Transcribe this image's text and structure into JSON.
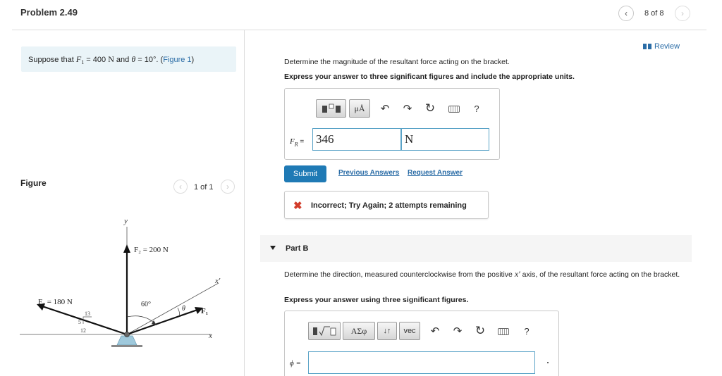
{
  "header": {
    "title": "Problem 2.49",
    "page_count": "8 of 8",
    "prev_icon": "chevron-left-icon",
    "next_icon": "chevron-right-icon"
  },
  "statement": {
    "prefix": "Suppose that ",
    "f1_symbol": "F",
    "f1_sub": "1",
    "f1_value": " = 400 ",
    "f1_unit": "N",
    "and": " and ",
    "theta_symbol": "θ",
    "theta_value": " = 10°. (",
    "figure_link": "Figure 1",
    "suffix": ")"
  },
  "figure": {
    "label": "Figure",
    "count": "1 of 1",
    "y_axis": "y",
    "x_axis": "x",
    "xprime_axis": "x′",
    "f2_label": "F₂ = 200 N",
    "f3_label": "F₃ = 180 N",
    "f1_label": "F₁",
    "angle_60": "60°",
    "theta": "θ",
    "tri_13": "13",
    "tri_5": "5",
    "tri_12": "12"
  },
  "review": {
    "label": "Review",
    "icon": "review-icon"
  },
  "partA": {
    "question": "Determine the magnitude of the resultant force acting on the bracket.",
    "instruction": "Express your answer to three significant figures and include the appropriate units.",
    "toolbar": {
      "templates_icon": "templates-icon",
      "units_label": "μÅ",
      "undo_icon": "undo-icon",
      "redo_icon": "redo-icon",
      "reset_icon": "reset-icon",
      "keyboard_icon": "keyboard-icon",
      "help_label": "?"
    },
    "answer_label_sym": "F",
    "answer_label_sub": "R",
    "answer_label_eq": " =",
    "value": "346",
    "units": "N",
    "submit_label": "Submit",
    "previous_answers": "Previous Answers",
    "request_answer": "Request Answer",
    "feedback_icon": "x-mark-icon",
    "feedback_mark": "✖",
    "feedback": "Incorrect; Try Again; 2 attempts remaining"
  },
  "partB": {
    "title": "Part B",
    "question_pre": "Determine the direction, measured counterclockwise from the positive ",
    "question_var": "x′",
    "question_post": " axis, of the resultant force acting on the bracket.",
    "instruction": "Express your answer using three significant figures.",
    "toolbar": {
      "templates_icon": "templates-icon",
      "greek_label": "AΣφ",
      "arrows_label": "↓↑",
      "vec_label": "vec",
      "undo_icon": "undo-icon",
      "redo_icon": "redo-icon",
      "reset_icon": "reset-icon",
      "keyboard_icon": "keyboard-icon",
      "help_label": "?"
    },
    "answer_label": "ϕ =",
    "value": ""
  },
  "colors": {
    "accent": "#1f7ab5",
    "link": "#2a6ca6",
    "error": "#d23c2a",
    "statement_bg": "#eaf4f8"
  }
}
